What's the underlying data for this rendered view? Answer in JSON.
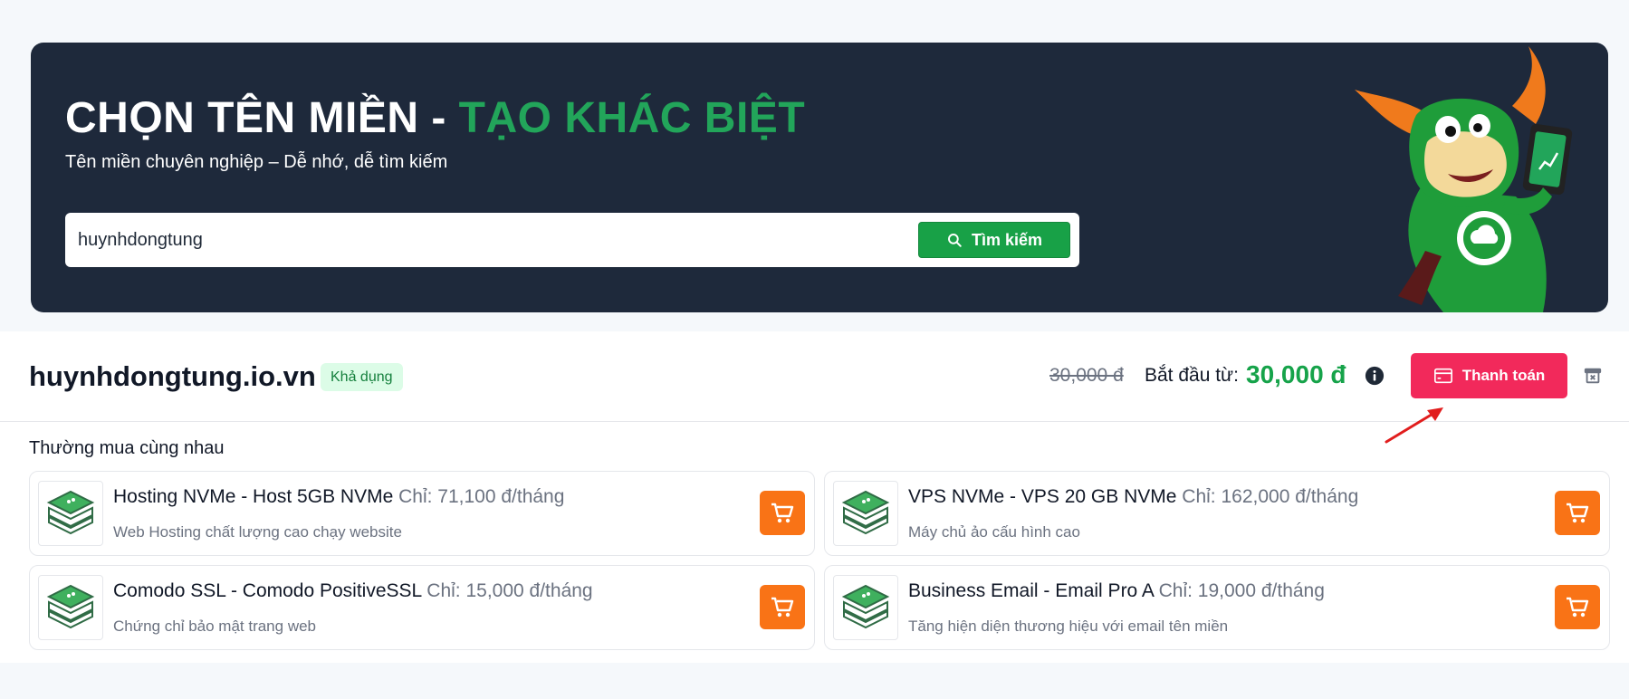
{
  "hero": {
    "title_main": "CHỌN TÊN MIỀN - ",
    "title_accent": "TẠO KHÁC BIỆT",
    "subtitle": "Tên miền chuyên nghiệp – Dễ nhớ, dễ tìm kiếm",
    "search_value": "huynhdongtung",
    "search_button": "Tìm kiếm"
  },
  "result": {
    "domain": "huynhdongtung.io.vn",
    "status": "Khả dụng",
    "old_price": "30,000 đ",
    "price_label": "Bắt đầu từ:",
    "price": "30,000 đ",
    "pay_button": "Thanh toán"
  },
  "bundle": {
    "title": "Thường mua cùng nhau",
    "items": [
      {
        "name": "Hosting NVMe - Host 5GB NVMe",
        "price": "Chỉ: 71,100 đ/tháng",
        "desc": "Web Hosting chất lượng cao chạy website"
      },
      {
        "name": "VPS NVMe - VPS 20 GB NVMe",
        "price": "Chỉ: 162,000 đ/tháng",
        "desc": "Máy chủ ảo cấu hình cao"
      },
      {
        "name": "Comodo SSL - Comodo PositiveSSL",
        "price": "Chỉ: 15,000 đ/tháng",
        "desc": "Chứng chỉ bảo mật trang web"
      },
      {
        "name": "Business Email - Email Pro A",
        "price": "Chỉ: 19,000 đ/tháng",
        "desc": "Tăng hiện diện thương hiệu với email tên miền"
      }
    ]
  },
  "icons": {
    "search": "search-icon",
    "info": "info-icon",
    "pay": "credit-card-icon",
    "trash": "archive-icon",
    "cart": "cart-icon",
    "product": "server-box-icon",
    "mascot": "mascot-illustration",
    "arrow": "red-arrow-annotation"
  },
  "colors": {
    "hero_bg": "#1e293b",
    "accent_green": "#22a55a",
    "pay_button": "#f2295b",
    "cart_button": "#f97316",
    "price_green": "#16a34a"
  }
}
